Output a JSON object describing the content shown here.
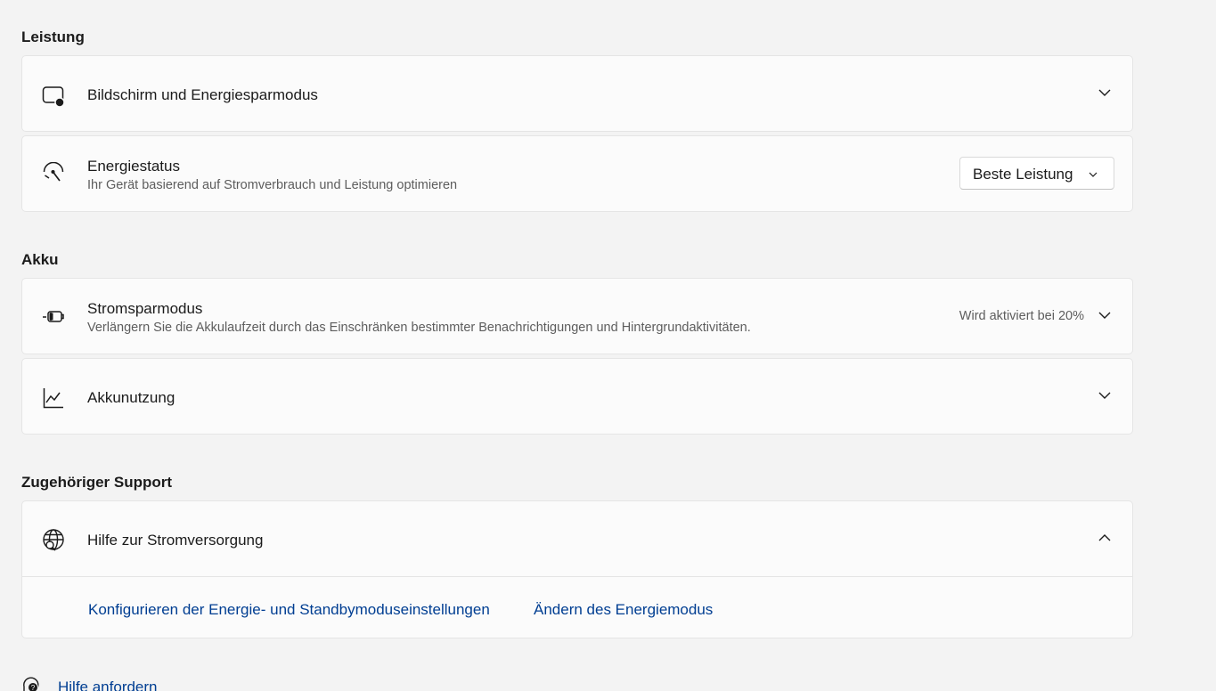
{
  "sections": {
    "performance": {
      "title": "Leistung",
      "screen_sleep": {
        "title": "Bildschirm und Energiesparmodus",
        "icon": "screen-sleep-icon"
      },
      "power_mode": {
        "title": "Energiestatus",
        "subtitle": "Ihr Gerät basierend auf Stromverbrauch und Leistung optimieren",
        "icon": "power-gauge-icon",
        "selected": "Beste Leistung"
      }
    },
    "battery": {
      "title": "Akku",
      "battery_saver": {
        "title": "Stromsparmodus",
        "subtitle": "Verlängern Sie die Akkulaufzeit durch das Einschränken bestimmter Benachrichtigungen und Hintergrundaktivitäten.",
        "status": "Wird aktiviert bei 20%",
        "icon": "battery-saver-icon"
      },
      "battery_usage": {
        "title": "Akkunutzung",
        "icon": "line-chart-icon"
      }
    },
    "support": {
      "title": "Zugehöriger Support",
      "power_help": {
        "title": "Hilfe zur Stromversorgung",
        "icon": "globe-search-icon",
        "links": [
          "Konfigurieren der Energie- und Standbymoduseinstellungen",
          "Ändern des Energiemodus"
        ]
      }
    }
  },
  "footer": {
    "help_label": "Hilfe anfordern",
    "help_icon": "help-chat-icon"
  },
  "colors": {
    "background": "#f3f3f3",
    "card": "#fbfbfb",
    "link": "#003e92",
    "secondary_text": "#5d5d5d"
  }
}
